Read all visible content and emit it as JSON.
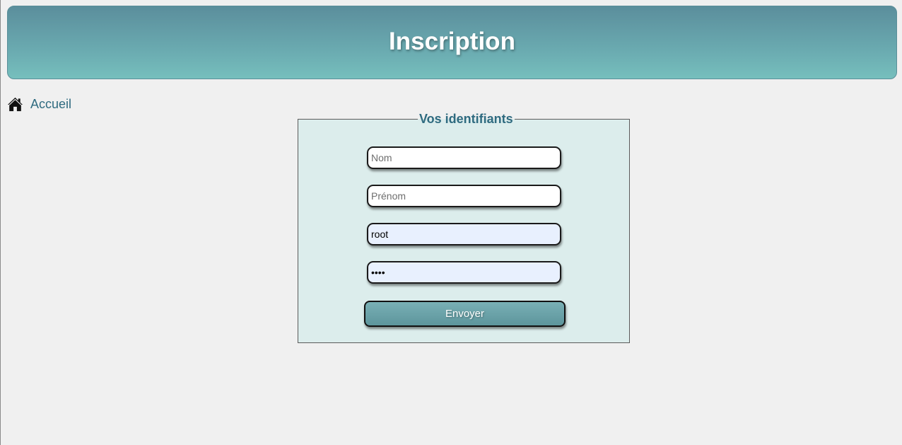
{
  "header": {
    "title": "Inscription"
  },
  "nav": {
    "home_icon": "home-icon",
    "home_label": "Accueil"
  },
  "form": {
    "legend": "Vos identifiants",
    "fields": {
      "nom": {
        "placeholder": "Nom",
        "value": ""
      },
      "prenom": {
        "placeholder": "Prénom",
        "value": ""
      },
      "login": {
        "placeholder": "",
        "value": "root"
      },
      "password": {
        "placeholder": "",
        "value": "••••"
      }
    },
    "submit_label": "Envoyer"
  },
  "colors": {
    "header_gradient_top": "#5b8e9c",
    "header_gradient_bottom": "#76bfbd",
    "accent_text": "#2f6b80",
    "form_background": "#dcedec",
    "autofill_background": "#e8f0fe",
    "page_background": "#f0f0f0"
  }
}
